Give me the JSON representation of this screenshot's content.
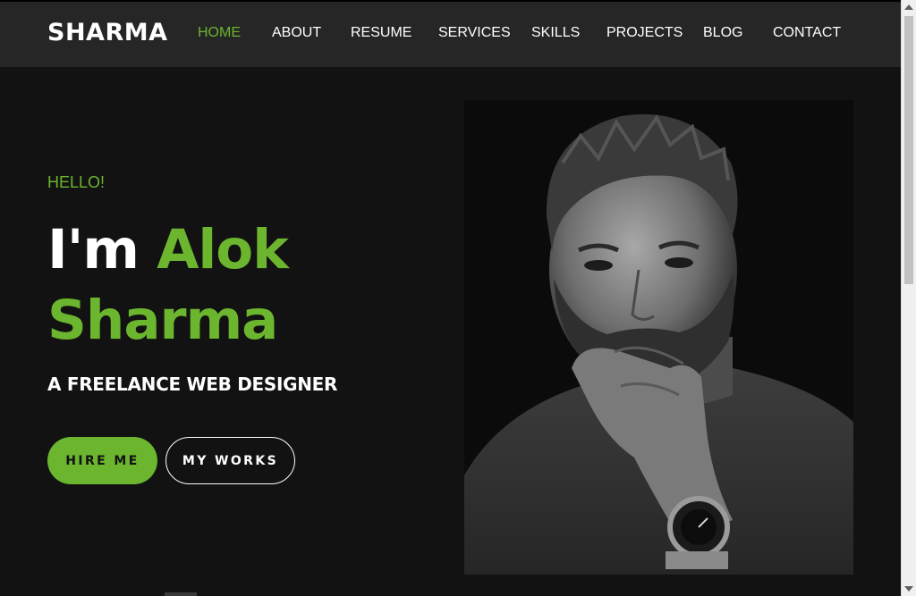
{
  "brand": {
    "name": "SHARMA"
  },
  "nav": {
    "items": [
      {
        "label": "HOME",
        "active": true
      },
      {
        "label": "ABOUT"
      },
      {
        "label": "RESUME"
      },
      {
        "label": "SERVICES"
      },
      {
        "label": "SKILLS"
      },
      {
        "label": "PROJECTS"
      },
      {
        "label": "BLOG"
      },
      {
        "label": "CONTACT"
      }
    ]
  },
  "hero": {
    "greeting": "HELLO!",
    "headline_prefix": "I'm",
    "headline_name_first": "Alok",
    "headline_name_last": "Sharma",
    "tagline": "A FREELANCE WEB DESIGNER",
    "primary_button": "HIRE ME",
    "secondary_button": "MY WORKS",
    "photo_icon": "portrait-photo"
  },
  "colors": {
    "accent": "#6bb52f",
    "background": "#121212",
    "header": "#262626",
    "text": "#ffffff"
  }
}
